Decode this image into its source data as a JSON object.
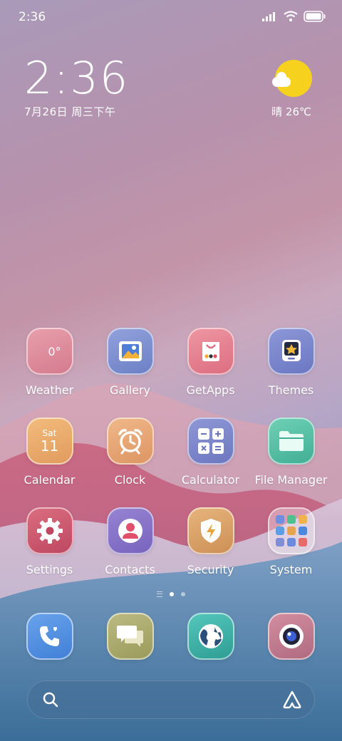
{
  "status_bar": {
    "time": "2:36",
    "icons": [
      "signal-icon",
      "wifi-icon",
      "battery-icon"
    ]
  },
  "clock_widget": {
    "time": "2:36",
    "date": "7月26日 周三下午"
  },
  "weather_widget": {
    "icon": "sun-cloud-icon",
    "text": "晴 26℃"
  },
  "apps": [
    {
      "label": "Weather",
      "icon": "weather-icon",
      "badge_text": "0°"
    },
    {
      "label": "Gallery",
      "icon": "gallery-icon"
    },
    {
      "label": "GetApps",
      "icon": "getapps-icon"
    },
    {
      "label": "Themes",
      "icon": "themes-icon"
    },
    {
      "label": "Calendar",
      "icon": "calendar-icon",
      "day": "Sat",
      "date": "11"
    },
    {
      "label": "Clock",
      "icon": "alarm-clock-icon"
    },
    {
      "label": "Calculator",
      "icon": "calculator-icon"
    },
    {
      "label": "File Manager",
      "icon": "folder-icon"
    },
    {
      "label": "Settings",
      "icon": "gear-icon"
    },
    {
      "label": "Contacts",
      "icon": "contact-icon"
    },
    {
      "label": "Security",
      "icon": "shield-icon"
    },
    {
      "label": "System",
      "icon": "folder-grid-icon"
    }
  ],
  "page_indicator": {
    "pages": 2,
    "active": 1
  },
  "dock": [
    {
      "name": "phone",
      "icon": "phone-icon"
    },
    {
      "name": "messages",
      "icon": "message-icon"
    },
    {
      "name": "browser",
      "icon": "globe-icon"
    },
    {
      "name": "camera",
      "icon": "camera-icon"
    }
  ],
  "search_bar": {
    "left_icon": "search-icon",
    "right_icon": "assistant-icon"
  },
  "colors": {
    "weather": "#d98a9a",
    "gallery": "#7c8fcf",
    "getapps": "#e07d8b",
    "themes": "#7684c9",
    "calendar": "#e8a969",
    "clock": "#e6a877",
    "calculator": "#7b86c6",
    "filemanager": "#55c0a6",
    "settings": "#c9566b",
    "contacts": "#8b74c6",
    "security": "#d69c63",
    "phone": "#4f8de0",
    "messages": "#a8a86e",
    "browser": "#3db3a8",
    "camera": "#c27a8e",
    "sun": "#f6d21e"
  }
}
